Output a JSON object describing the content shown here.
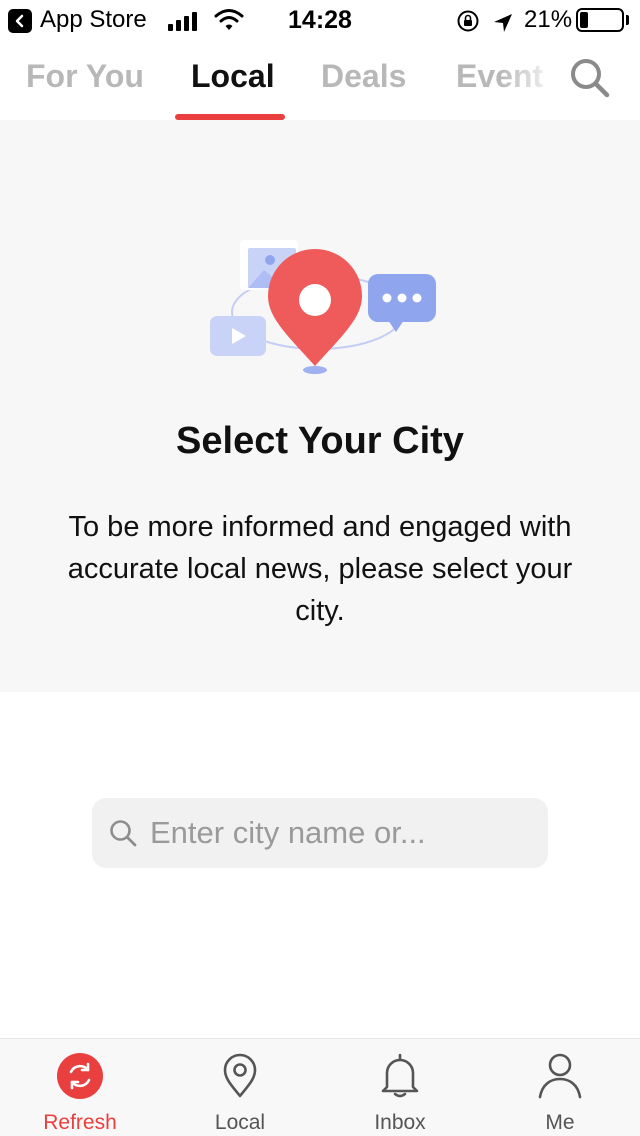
{
  "status_bar": {
    "back_label": "App Store",
    "time": "14:28",
    "battery_percent": "21%",
    "battery_level": 0.21,
    "icons": [
      "back-icon",
      "signal-icon",
      "wifi-icon",
      "orientation-lock-icon",
      "location-arrow-icon",
      "battery-icon"
    ]
  },
  "top_tabs": {
    "items": [
      {
        "label": "For You"
      },
      {
        "label": "Local"
      },
      {
        "label": "Deals"
      },
      {
        "label": "Event"
      }
    ],
    "active": "Local",
    "search_icon": "search-icon"
  },
  "hero": {
    "title": "Select Your City",
    "description": "To be more informed and engaged with accurate local news, please select your city.",
    "illustration_icon": "location-pin-icon"
  },
  "city_search": {
    "placeholder": "Enter city name or...",
    "value": ""
  },
  "bottom_nav": {
    "items": [
      {
        "label": "Refresh",
        "icon": "refresh-icon"
      },
      {
        "label": "Local",
        "icon": "location-pin-icon"
      },
      {
        "label": "Inbox",
        "icon": "bell-icon"
      },
      {
        "label": "Me",
        "icon": "person-icon"
      }
    ],
    "active": "Refresh"
  },
  "colors": {
    "accent": "#ea3f3f",
    "inactive_tab": "#b8b8b8",
    "hero_background": "#f7f7f7",
    "illustration_blue": "#8fa5ee"
  }
}
